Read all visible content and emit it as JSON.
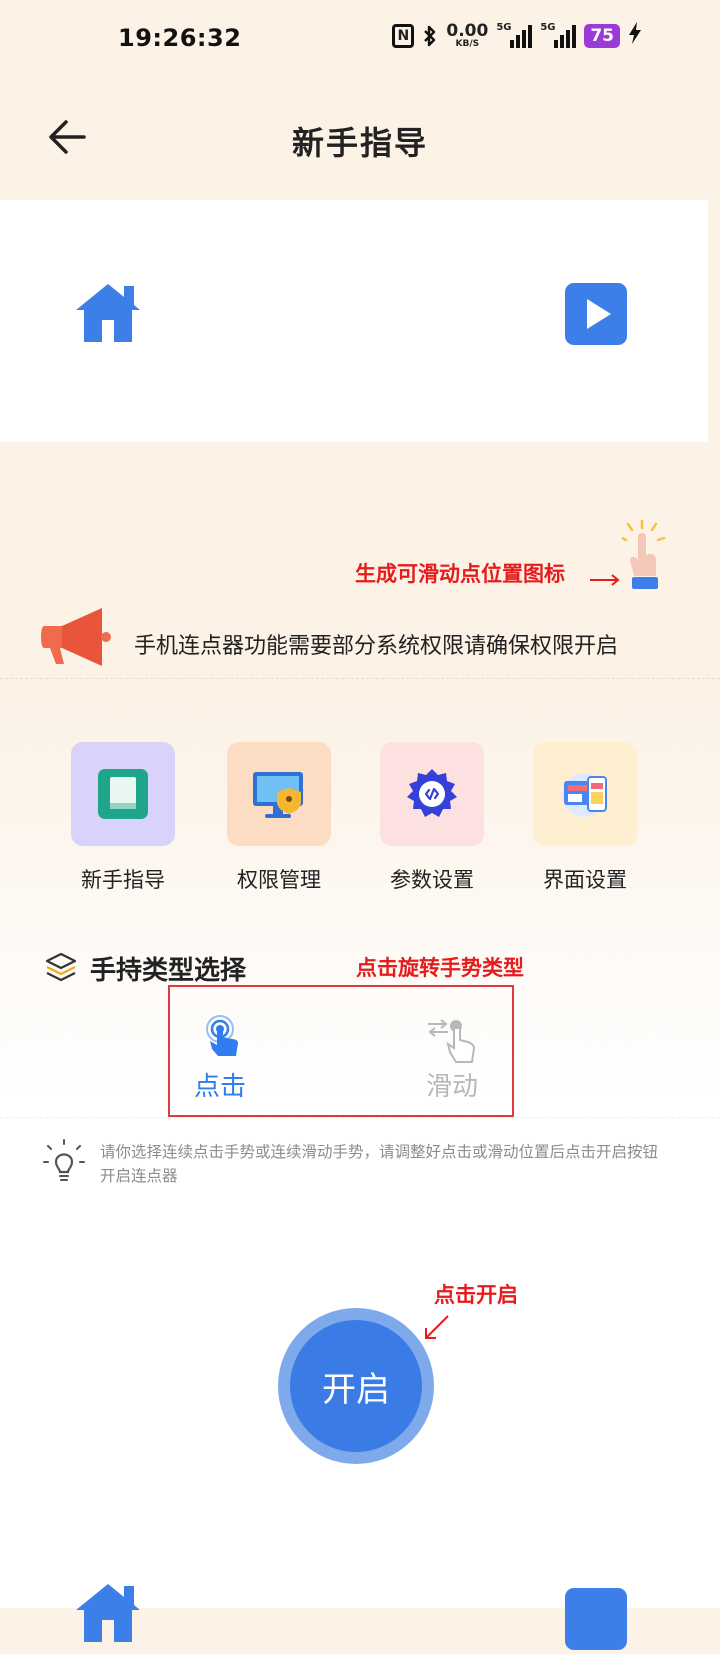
{
  "status_bar": {
    "time": "19:26:32",
    "nfc": "N",
    "net_speed_value": "0.00",
    "net_speed_unit": "KB/S",
    "signal1_label": "5G",
    "signal2_label": "5G",
    "battery": "75",
    "icons": [
      "nfc-icon",
      "bluetooth-icon",
      "signal-icon",
      "battery-icon",
      "charging-icon"
    ]
  },
  "header": {
    "title": "新手指导"
  },
  "annotations": {
    "float_icon_hint": "生成可滑动点位置图标",
    "rotate_hint": "点击旋转手势类型",
    "start_hint": "点击开启"
  },
  "notice": {
    "text": "手机连点器功能需要部分系统权限请确保权限开启"
  },
  "menu": [
    {
      "label": "新手指导",
      "icon": "guide-book-icon",
      "bg": "#d9d2fb"
    },
    {
      "label": "权限管理",
      "icon": "permission-monitor-icon",
      "bg": "#fddcc4"
    },
    {
      "label": "参数设置",
      "icon": "gear-code-icon",
      "bg": "#fde1e1"
    },
    {
      "label": "界面设置",
      "icon": "ui-devices-icon",
      "bg": "#fdefcf"
    }
  ],
  "gesture_section": {
    "title": "手持类型选择",
    "options": [
      {
        "label": "点击",
        "icon": "tap-icon",
        "selected": true,
        "color": "#2f7df0"
      },
      {
        "label": "滑动",
        "icon": "swipe-icon",
        "selected": false,
        "color": "#b8b8b8"
      }
    ]
  },
  "hint": {
    "text": "请你选择连续点击手势或连续滑动手势，请调整好点击或滑动位置后点击开启按钮开启连点器"
  },
  "start_button": {
    "label": "开启"
  },
  "colors": {
    "accent": "#3b7be6",
    "annotation": "#e61c1c",
    "background": "#fcf2e6"
  }
}
